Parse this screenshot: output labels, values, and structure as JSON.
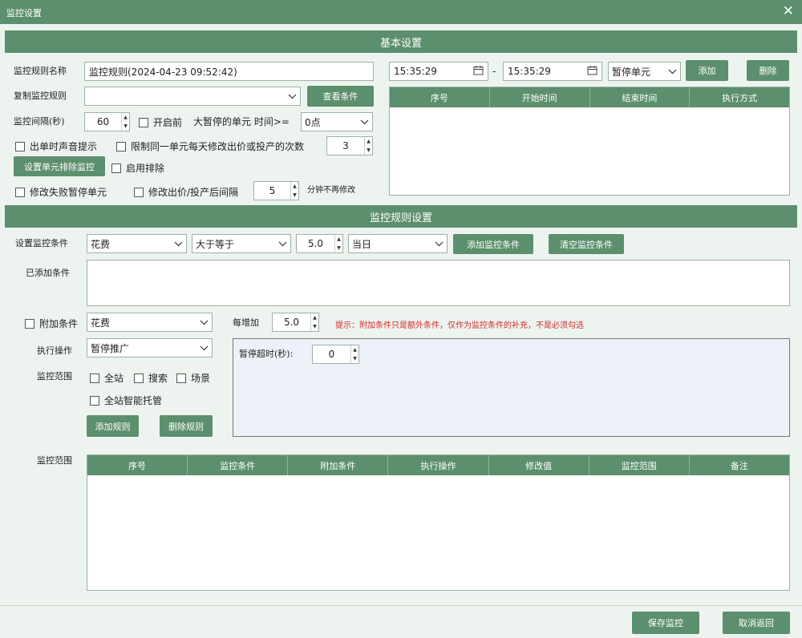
{
  "window": {
    "title": "监控设置"
  },
  "basic": {
    "header": "基本设置",
    "rule_name_label": "监控规则名称",
    "rule_name_value": "监控规则(2024-04-23 09:52:42)",
    "copy_rule_label": "复制监控规则",
    "copy_rule_value": "",
    "view_conditions_btn": "查看条件",
    "interval_label": "监控间隔(秒)",
    "interval_value": "60",
    "before_start_label": "开启前",
    "max_pause_label": "大暂停的单元 时间>=",
    "max_pause_value": "0点",
    "sound_alert_label": "出单时声音提示",
    "limit_label": "限制同一单元每天修改出价或投产的次数",
    "limit_value": "3",
    "exclude_btn": "设置单元排除监控",
    "enable_exclude_label": "启用排除",
    "modify_fail_label": "修改失败暂停单元",
    "modify_interval_label": "修改出价/投产后间隔",
    "modify_interval_value": "5",
    "modify_interval_unit": "分钟不再修改"
  },
  "schedule": {
    "start_time": "15:35:29",
    "dash": "-",
    "end_time": "15:35:29",
    "mode": "暂停单元",
    "add_btn": "添加",
    "delete_btn": "删除",
    "columns": [
      "序号",
      "开始时间",
      "结束时间",
      "执行方式"
    ]
  },
  "rules": {
    "header": "监控规则设置",
    "set_condition_label": "设置监控条件",
    "cond_field": "花费",
    "cond_op": "大于等于",
    "cond_value": "5.0",
    "cond_period": "当日",
    "add_cond_btn": "添加监控条件",
    "clear_cond_btn": "清空监控条件",
    "added_label": "已添加条件",
    "added_value": "",
    "extra_label": "附加条件",
    "extra_field": "花费",
    "increase_label": "每增加",
    "increase_value": "5.0",
    "hint": "提示：附加条件只是额外条件，仅作为监控条件的补充，不是必须勾选",
    "action_label": "执行操作",
    "action_value": "暂停推广",
    "pause_timeout_label": "暂停超时(秒):",
    "pause_timeout_value": "0",
    "scope_label": "监控范围",
    "scope_all_site": "全站",
    "scope_search": "搜索",
    "scope_scene": "场景",
    "scope_smart": "全站智能托管",
    "add_rule_btn": "添加规则",
    "del_rule_btn": "删除规则",
    "list_label": "监控范围",
    "columns": [
      "序号",
      "监控条件",
      "附加条件",
      "执行操作",
      "修改值",
      "监控范围",
      "备注"
    ]
  },
  "footer": {
    "save_btn": "保存监控",
    "cancel_btn": "取消返回"
  },
  "colors": {
    "accent": "#5c8f6d",
    "background": "#edf4ef",
    "hint": "#d22b2b"
  }
}
